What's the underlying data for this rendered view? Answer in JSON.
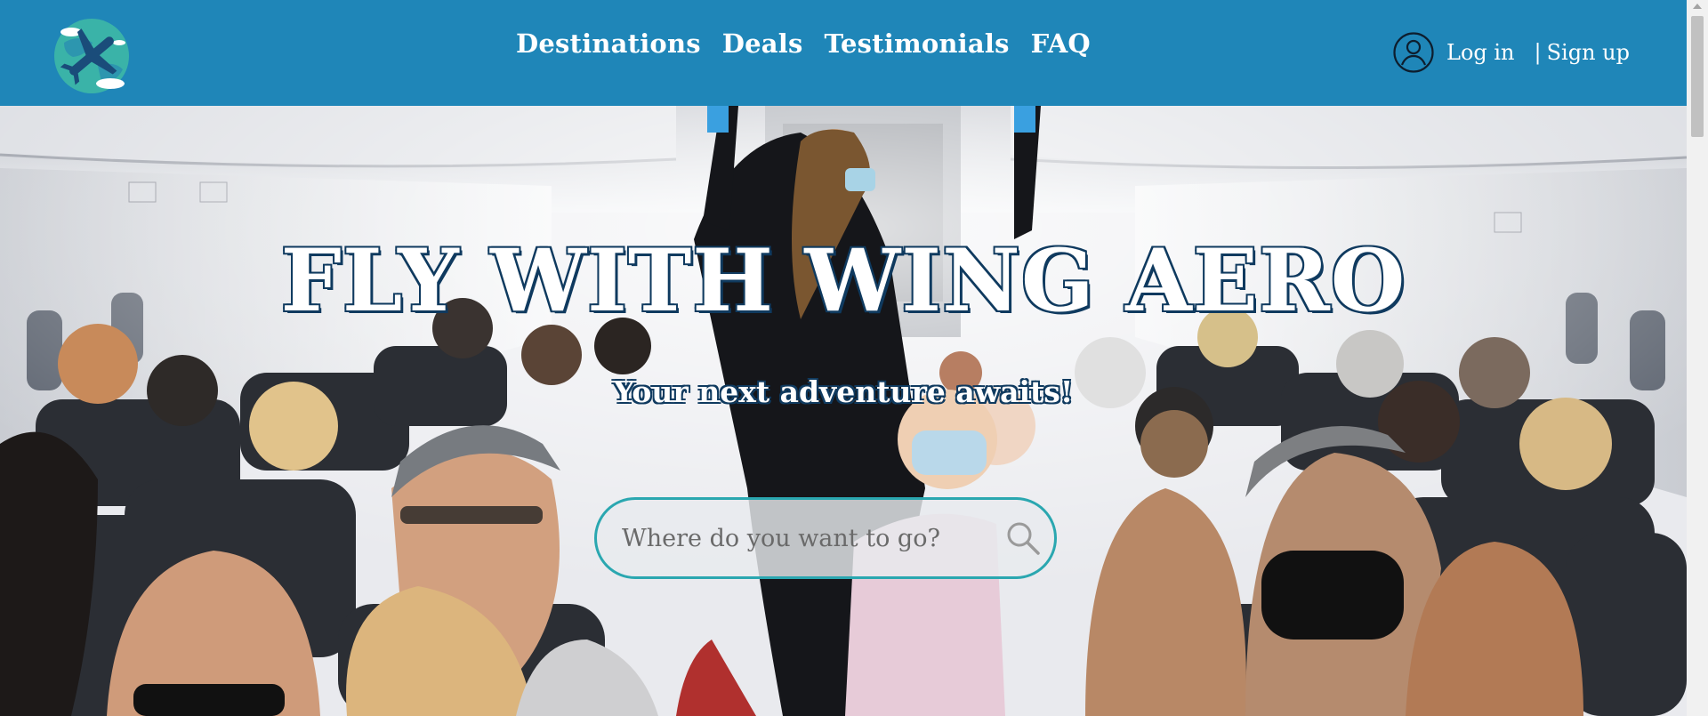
{
  "brand": {
    "logo_icon": "airplane-globe-logo",
    "primary_color": "#1f86b8",
    "accent_color": "#2aa7b0",
    "title_outline_color": "#0f3a5f"
  },
  "nav": {
    "links": [
      {
        "label": "Destinations"
      },
      {
        "label": "Deals"
      },
      {
        "label": "Testimonials"
      },
      {
        "label": "FAQ"
      }
    ]
  },
  "auth": {
    "user_icon": "user-circle-icon",
    "login_label": "Log in",
    "separator": "|",
    "signup_label": "Sign up"
  },
  "hero": {
    "title": "FLY WITH WING AERO",
    "subtitle": "Your next adventure awaits!",
    "background": "airplane-cabin-passengers-photo"
  },
  "search": {
    "placeholder": "Where do you want to go?",
    "value": "",
    "icon": "search-icon"
  }
}
